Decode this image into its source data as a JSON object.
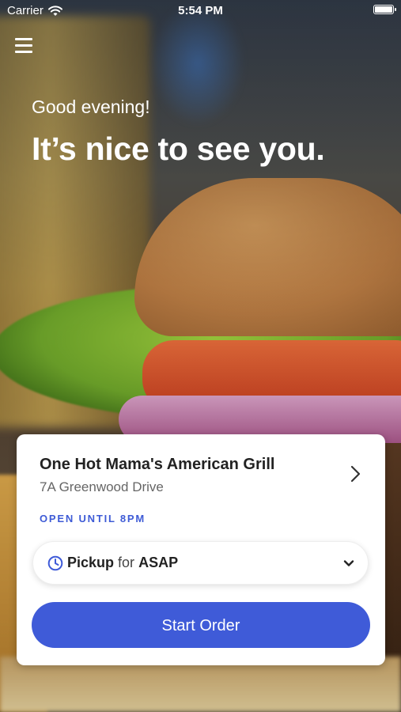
{
  "status_bar": {
    "carrier": "Carrier",
    "time": "5:54 PM"
  },
  "hero": {
    "greeting": "Good evening!",
    "headline": "It’s nice to see you."
  },
  "restaurant": {
    "name": "One Hot Mama's American Grill",
    "address": "7A Greenwood Drive",
    "hours": "OPEN UNTIL 8PM"
  },
  "order_mode": {
    "mode": "Pickup",
    "connector": "for",
    "time": "ASAP"
  },
  "actions": {
    "start_order": "Start Order"
  },
  "colors": {
    "accent": "#3f5bd8",
    "hours_text": "#3e5bd6"
  },
  "icons": [
    "wifi-icon",
    "battery-icon",
    "menu-icon",
    "chevron-right-icon",
    "clock-icon",
    "chevron-down-icon"
  ]
}
